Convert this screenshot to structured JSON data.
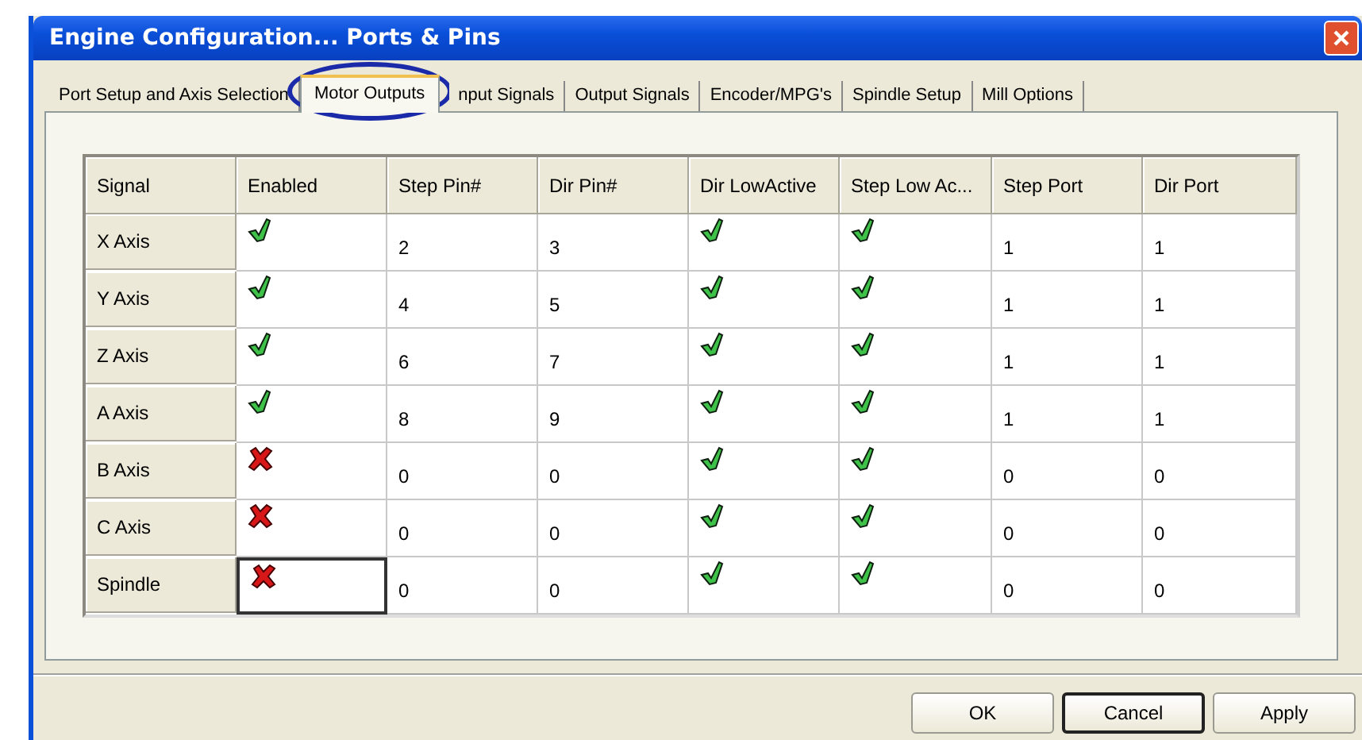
{
  "window": {
    "title": "Engine Configuration... Ports & Pins"
  },
  "tabs": [
    {
      "label": "Port Setup and Axis Selection",
      "selected": false
    },
    {
      "label": "Motor Outputs",
      "selected": true
    },
    {
      "label": "nput Signals",
      "selected": false
    },
    {
      "label": "Output Signals",
      "selected": false
    },
    {
      "label": "Encoder/MPG's",
      "selected": false
    },
    {
      "label": "Spindle Setup",
      "selected": false
    },
    {
      "label": "Mill Options",
      "selected": false
    }
  ],
  "table": {
    "columns": [
      "Signal",
      "Enabled",
      "Step Pin#",
      "Dir Pin#",
      "Dir LowActive",
      "Step Low Ac...",
      "Step Port",
      "Dir Port"
    ],
    "rows": [
      {
        "signal": "X Axis",
        "enabled": true,
        "focused": false,
        "step_pin": "2",
        "dir_pin": "3",
        "dir_low_active": true,
        "step_low_active": true,
        "step_port": "1",
        "dir_port": "1"
      },
      {
        "signal": "Y Axis",
        "enabled": true,
        "focused": false,
        "step_pin": "4",
        "dir_pin": "5",
        "dir_low_active": true,
        "step_low_active": true,
        "step_port": "1",
        "dir_port": "1"
      },
      {
        "signal": "Z Axis",
        "enabled": true,
        "focused": false,
        "step_pin": "6",
        "dir_pin": "7",
        "dir_low_active": true,
        "step_low_active": true,
        "step_port": "1",
        "dir_port": "1"
      },
      {
        "signal": "A Axis",
        "enabled": true,
        "focused": false,
        "step_pin": "8",
        "dir_pin": "9",
        "dir_low_active": true,
        "step_low_active": true,
        "step_port": "1",
        "dir_port": "1"
      },
      {
        "signal": "B Axis",
        "enabled": false,
        "focused": false,
        "step_pin": "0",
        "dir_pin": "0",
        "dir_low_active": true,
        "step_low_active": true,
        "step_port": "0",
        "dir_port": "0"
      },
      {
        "signal": "C Axis",
        "enabled": false,
        "focused": false,
        "step_pin": "0",
        "dir_pin": "0",
        "dir_low_active": true,
        "step_low_active": true,
        "step_port": "0",
        "dir_port": "0"
      },
      {
        "signal": "Spindle",
        "enabled": false,
        "focused": true,
        "step_pin": "0",
        "dir_pin": "0",
        "dir_low_active": true,
        "step_low_active": true,
        "step_port": "0",
        "dir_port": "0"
      }
    ]
  },
  "buttons": [
    {
      "label": "OK",
      "focused": false
    },
    {
      "label": "Cancel",
      "focused": true
    },
    {
      "label": "Apply",
      "focused": false
    }
  ]
}
